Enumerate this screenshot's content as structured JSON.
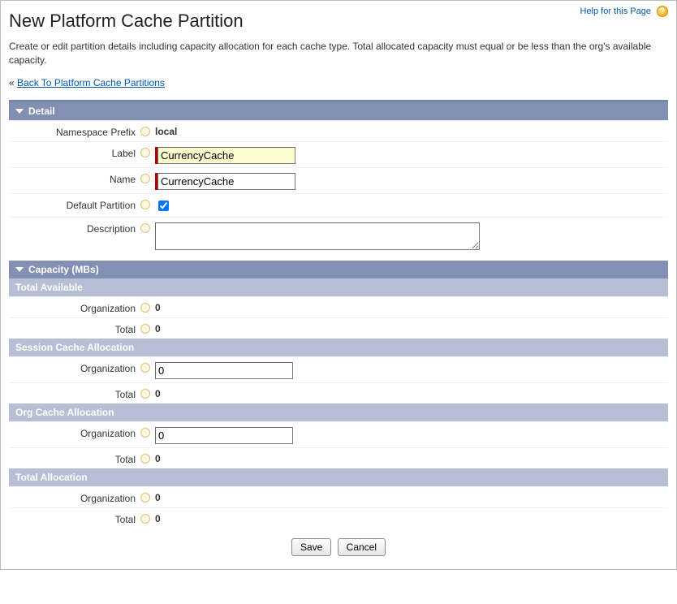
{
  "help": {
    "label": "Help for this Page",
    "icon": "?"
  },
  "page": {
    "title": "New Platform Cache Partition",
    "intro": "Create or edit partition details including capacity allocation for each cache type. Total allocated capacity must equal or be less than the org's available capacity.",
    "back_prefix": "« ",
    "back_label": "Back To Platform Cache Partitions"
  },
  "detail": {
    "header": "Detail",
    "namespace_label": "Namespace Prefix",
    "namespace_value": "local",
    "label_label": "Label",
    "label_value": "CurrencyCache",
    "name_label": "Name",
    "name_value": "CurrencyCache",
    "default_label": "Default Partition",
    "default_checked": true,
    "description_label": "Description",
    "description_value": ""
  },
  "capacity": {
    "header": "Capacity (MBs)",
    "total_available_header": "Total Available",
    "session_header": "Session Cache Allocation",
    "org_header": "Org Cache Allocation",
    "total_alloc_header": "Total Allocation",
    "organization_label": "Organization",
    "total_label": "Total",
    "total_available_org": "0",
    "total_available_total": "0",
    "session_org_value": "0",
    "session_total": "0",
    "org_org_value": "0",
    "org_total": "0",
    "total_alloc_org": "0",
    "total_alloc_total": "0"
  },
  "buttons": {
    "save": "Save",
    "cancel": "Cancel"
  }
}
